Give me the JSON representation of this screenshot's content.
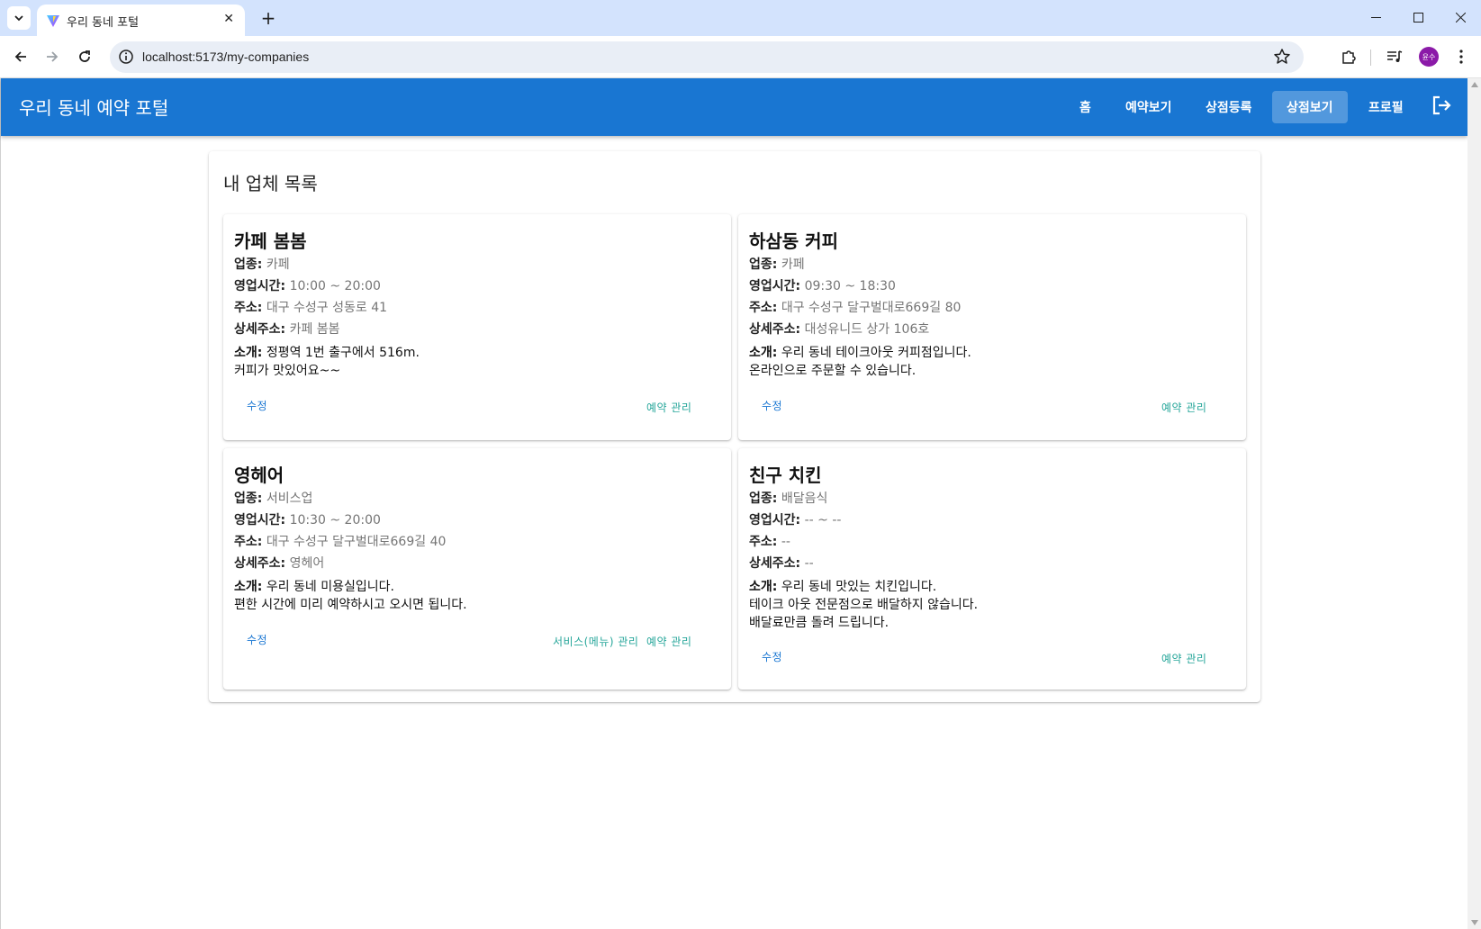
{
  "browser": {
    "tab_title": "우리 동네 포털",
    "url": "localhost:5173/my-companies",
    "profile_initials": "윤수"
  },
  "app": {
    "brand": "우리 동네 예약 포털",
    "nav": [
      "홈",
      "예약보기",
      "상점등록",
      "상점보기",
      "프로필"
    ],
    "active_nav": "상점보기"
  },
  "page": {
    "title": "내 업체 목록"
  },
  "labels": {
    "category": "업종:",
    "hours": "영업시간:",
    "address": "주소:",
    "detail_address": "상세주소:",
    "intro": "소개:"
  },
  "buttons": {
    "edit": "수정",
    "reservations": "예약 관리",
    "services": "서비스(메뉴) 관리"
  },
  "companies": [
    {
      "name": "카페 봄봄",
      "category": "카페",
      "hours": "10:00 ~ 20:00",
      "address": "대구 수성구 성동로 41",
      "detail_address": "카페 봄봄",
      "intro_lines": [
        "정평역 1번 출구에서 516m.",
        "커피가 맛있어요~~"
      ]
    },
    {
      "name": "하삼동 커피",
      "category": "카페",
      "hours": "09:30 ~ 18:30",
      "address": "대구 수성구 달구벌대로669길 80",
      "detail_address": "대성유니드 상가 106호",
      "intro_lines": [
        "우리 동네 테이크아웃 커피점입니다.",
        "온라인으로 주문할 수 있습니다."
      ]
    },
    {
      "name": "영헤어",
      "category": "서비스업",
      "hours": "10:30 ~ 20:00",
      "address": "대구 수성구 달구벌대로669길 40",
      "detail_address": "영헤어",
      "intro_lines": [
        "우리 동네 미용실입니다.",
        "편한 시간에 미리 예약하시고 오시면 됩니다."
      ]
    },
    {
      "name": "친구 치킨",
      "category": "배달음식",
      "hours": "-- ~ --",
      "address": "--",
      "detail_address": "--",
      "intro_lines": [
        "우리 동네 맛있는 치킨입니다.",
        "테이크 아웃 전문점으로 배달하지 않습니다.",
        "배달료만큼 돌려 드립니다."
      ]
    }
  ]
}
